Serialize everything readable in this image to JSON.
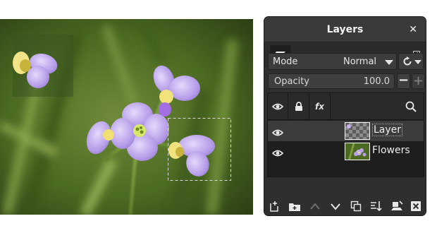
{
  "dialog": {
    "title": "Layers",
    "close_icon": "close-icon",
    "tab_icon": "layers-stack-icon",
    "tab_menu_icon": "tab-menu-icon"
  },
  "mode": {
    "label": "Mode",
    "value": "Normal",
    "composite_icon": "composite-reset-icon"
  },
  "opacity": {
    "label": "Opacity",
    "value": "100.0",
    "minus": "−",
    "plus": "+"
  },
  "list_header": {
    "visibility_icon": "eye-icon",
    "lock_icon": "lock-icon",
    "effects_label": "fx",
    "search_icon": "search-icon"
  },
  "layers": [
    {
      "name": "Layer",
      "visible": true,
      "selected": true,
      "thumbnail": "transparent-checkerboard"
    },
    {
      "name": "Flowers",
      "visible": true,
      "selected": false,
      "thumbnail": "flowers-photo"
    }
  ],
  "bottom_toolbar": [
    "new-layer-icon",
    "new-layer-group-icon",
    "raise-layer-icon",
    "lower-layer-icon",
    "duplicate-layer-icon",
    "merge-down-icon",
    "anchor-layer-icon",
    "delete-layer-icon"
  ],
  "colors": {
    "dialog_bg": "#2f2f2f",
    "selected_row": "#3c3c3c",
    "flower_petal": "#b9a2e8",
    "background_green": "#5a7a2a"
  }
}
